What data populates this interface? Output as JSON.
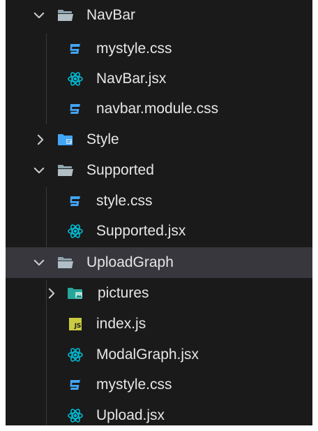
{
  "tree": {
    "navbar": {
      "label": "NavBar",
      "children": {
        "mystyle": "mystyle.css",
        "navbar_jsx": "NavBar.jsx",
        "navbar_module": "navbar.module.css"
      }
    },
    "style": {
      "label": "Style"
    },
    "supported": {
      "label": "Supported",
      "children": {
        "style_css": "style.css",
        "supported_jsx": "Supported.jsx"
      }
    },
    "uploadgraph": {
      "label": "UploadGraph",
      "children": {
        "pictures": "pictures",
        "index_js": "index.js",
        "modalgraph_jsx": "ModalGraph.jsx",
        "mystyle": "mystyle.css",
        "upload_jsx": "Upload.jsx"
      }
    }
  },
  "icons": {
    "js_badge": "JS"
  },
  "colors": {
    "background": "#1a1a1a",
    "selected_row": "#37373d",
    "text": "#e6e6e6",
    "css_icon": "#42a5f5",
    "react_icon": "#00bcd4",
    "folder_icon": "#90a4ae",
    "style_folder_icon": "#42a5f5",
    "pictures_folder_icon": "#26a69a",
    "js_icon": "#cbcb41"
  }
}
